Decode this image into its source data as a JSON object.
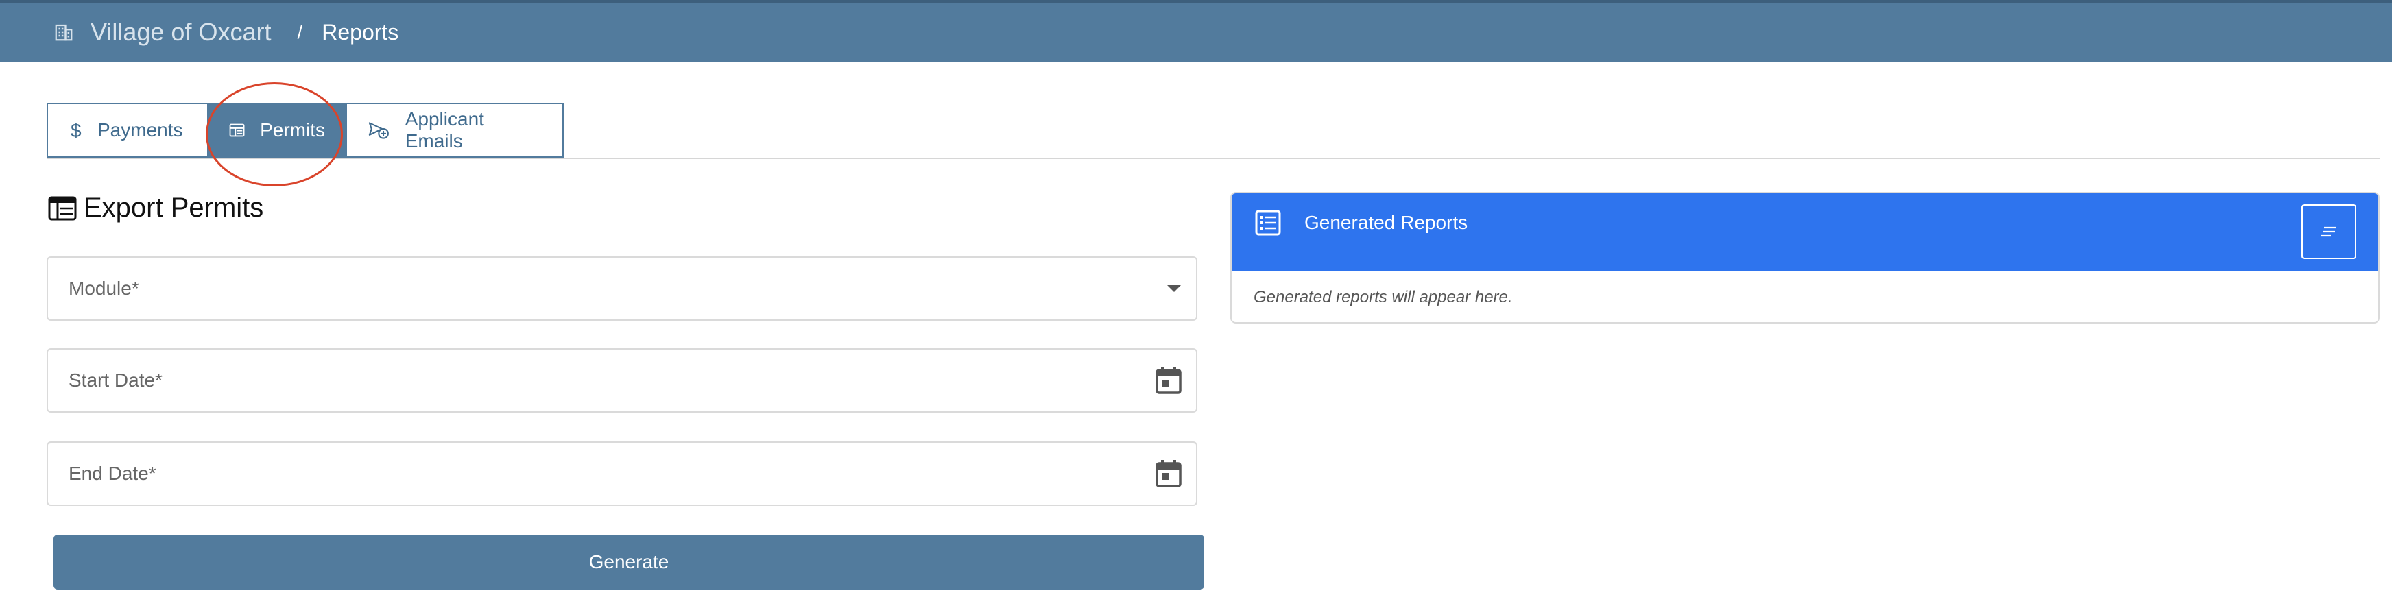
{
  "header": {
    "org_name": "Village of Oxcart",
    "separator": "/",
    "current_page": "Reports",
    "bg_color": "#527b9d"
  },
  "tabs": [
    {
      "label": "Payments",
      "icon": "dollar-icon",
      "active": false
    },
    {
      "label": "Permits",
      "icon": "permit-table-icon",
      "active": true
    },
    {
      "label": "Applicant Emails",
      "icon": "send-email-icon",
      "active": false
    }
  ],
  "form": {
    "title": "Export Permits",
    "title_icon": "calendar-table-icon",
    "module_label": "Module*",
    "start_date_label": "Start Date*",
    "end_date_label": "End Date*",
    "generate_label": "Generate"
  },
  "reports_panel": {
    "title": "Generated Reports",
    "empty_text": "Generated reports will appear here.",
    "header_color": "#2e74ee"
  },
  "annotation": {
    "color": "#d9442b"
  }
}
